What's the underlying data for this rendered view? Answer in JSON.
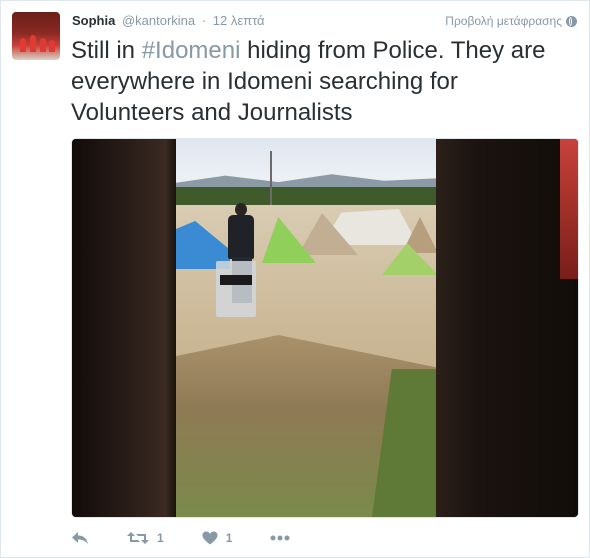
{
  "tweet": {
    "fullname": "Sophia",
    "username": "@kantorkina",
    "separator": "·",
    "time": "12 λεπτά",
    "translate_label": "Προβολή μετάφρασης",
    "text_before": "Still in ",
    "hashtag_symbol": "#",
    "hashtag_word": "Idomeni",
    "text_after": " hiding from Police. They are everywhere in Idomeni searching for Volunteers and Journalists",
    "photo": {
      "shield_text": "ΑΣΤΥΝΟΜΙΑ POLICE"
    }
  },
  "actions": {
    "reply_icon": "reply-icon",
    "retweet_icon": "retweet-icon",
    "retweet_count": "1",
    "like_icon": "heart-icon",
    "like_count": "1",
    "more_icon": "more-dots-icon"
  },
  "colors": {
    "text": "#292f33",
    "muted": "#8899a6",
    "border": "#e1e8ed"
  }
}
